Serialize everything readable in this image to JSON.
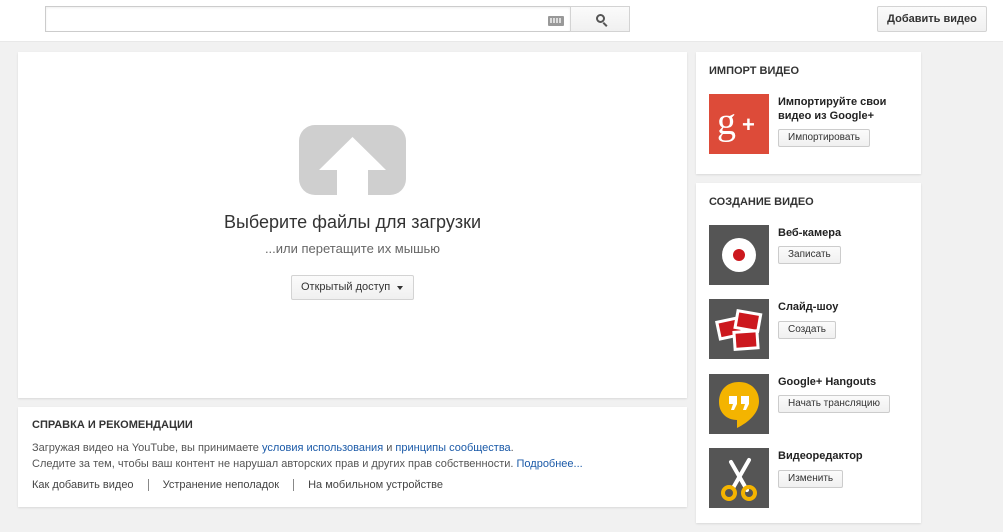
{
  "header": {
    "search_placeholder": "",
    "keyboard_icon": "keyboard-icon",
    "search_icon": "search-icon",
    "upload_button": "Добавить видео"
  },
  "upload": {
    "title": "Выберите файлы для загрузки",
    "hint": "...или перетащите их мышью",
    "privacy_select": "Открытый доступ"
  },
  "help": {
    "title": "СПРАВКА И РЕКОМЕНДАЦИИ",
    "line1_prefix": "Загружая видео на YouTube, вы принимаете ",
    "line1_link1": "условия использования",
    "line1_mid": " и ",
    "line1_link2": "принципы сообщества",
    "line1_suffix": ".",
    "line2_text": "Следите за тем, чтобы ваш контент не нарушал авторских прав и других прав собственности. ",
    "line2_link": "Подробнее...",
    "links": [
      "Как добавить видео",
      "Устранение неполадок",
      "На мобильном устройстве"
    ]
  },
  "import": {
    "title": "ИМПОРТ ВИДЕО",
    "item_title_line1": "Импортируйте свои",
    "item_title_line2": "видео из Google+",
    "button": "Импортировать"
  },
  "create": {
    "title": "СОЗДАНИЕ ВИДЕО",
    "items": [
      {
        "title": "Веб-камера",
        "button": "Записать",
        "icon": "webcam-record-icon"
      },
      {
        "title": "Слайд-шоу",
        "button": "Создать",
        "icon": "slideshow-icon"
      },
      {
        "title": "Google+ Hangouts",
        "button": "Начать трансляцию",
        "icon": "hangouts-icon"
      },
      {
        "title": "Видеоредактор",
        "button": "Изменить",
        "icon": "scissors-icon"
      }
    ]
  },
  "colors": {
    "google_plus_red": "#dd4b39",
    "tile_gray": "#555555",
    "hangouts_yellow": "#f4b400",
    "link_blue": "#1b5aa8"
  }
}
